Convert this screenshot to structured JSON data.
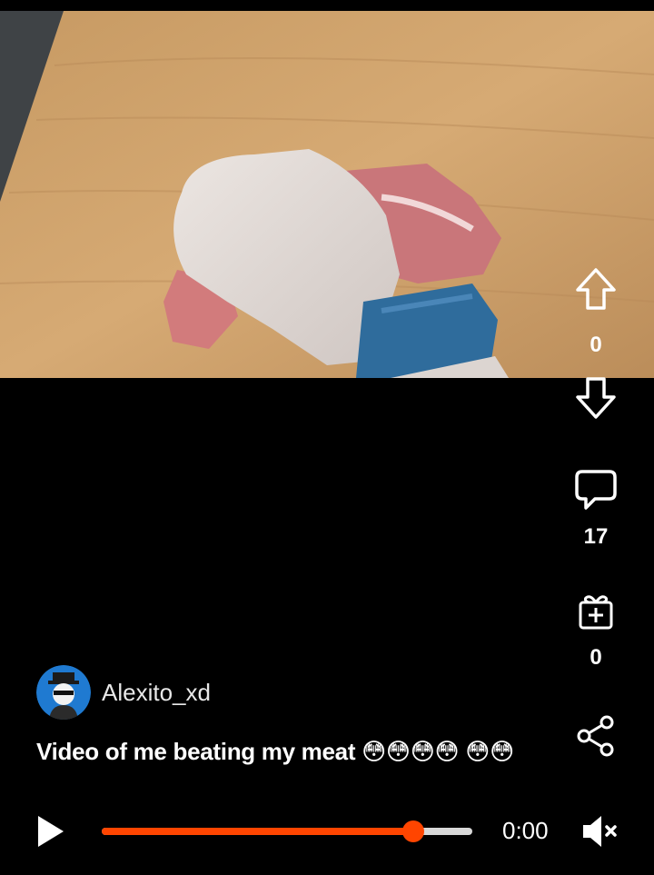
{
  "rail": {
    "upvote_count": "0",
    "comment_count": "17",
    "award_count": "0"
  },
  "post": {
    "username": "Alexito_xd",
    "caption_text": "Video of me beating my meat",
    "caption_emojis": "😳😳😳😳 😳😳"
  },
  "player": {
    "time": "0:00",
    "progress": 0.84
  },
  "colors": {
    "accent": "#ff4500",
    "track": "#d8d8d8",
    "avatar_bg": "#1f7ad1"
  },
  "icons": {
    "upvote": "arrow-up-outline",
    "downvote": "arrow-down-outline",
    "comment": "speech-bubble-outline",
    "award": "gift-box-plus",
    "share": "share-nodes",
    "play": "play-triangle",
    "mute": "speaker-muted"
  }
}
